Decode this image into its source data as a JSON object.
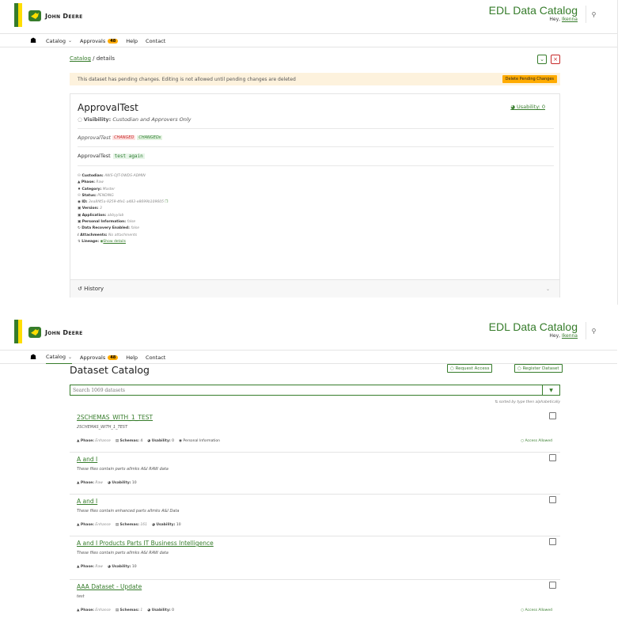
{
  "header": {
    "brand": "John Deere",
    "app_title": "EDL Data Catalog",
    "greeting": "Hey,",
    "user": "Ikenna",
    "search_icon": "magnifier-icon"
  },
  "nav": {
    "catalog": "Catalog",
    "approvals": "Approvals",
    "approvals_count": "48",
    "help": "Help",
    "contact": "Contact"
  },
  "details": {
    "breadcrumb_link": "Catalog",
    "breadcrumb_sep": "/",
    "breadcrumb_current": "details",
    "warning_text": "This dataset has pending changes. Editing is not allowed until pending changes are deleted",
    "delete_pending_label": "Delete Pending Changes",
    "name": "ApprovalTest",
    "visibility_label": "Visibility:",
    "visibility_value": "Custodian and Approvers Only",
    "usability_label": "Usability: 0",
    "desc_old_base": "ApprovalTest",
    "desc_removed": "CHANGED",
    "desc_added": "CHANGEDs",
    "desc_new_base": "ApprovalTest",
    "desc_new_code": "test again",
    "props": [
      {
        "label": "Custodian:",
        "value": "AWS-OJT-OWDS-ADMIN",
        "icon": "people-icon"
      },
      {
        "label": "Phase:",
        "value": "Raw",
        "icon": "phase-icon"
      },
      {
        "label": "Category:",
        "value": "Master",
        "icon": "category-icon"
      },
      {
        "label": "Status:",
        "value": "PENDING",
        "icon": "status-icon"
      },
      {
        "label": "ID:",
        "value": "3ea8f45a-9259-4fe1-a483-e8699b109605",
        "icon": "id-icon"
      },
      {
        "label": "Version:",
        "value": "3",
        "icon": "version-icon"
      },
      {
        "label": "Application:",
        "value": "abbyylab",
        "icon": "application-icon"
      },
      {
        "label": "Personal Information:",
        "value": "false",
        "icon": "personal-info-icon"
      },
      {
        "label": "Data Recovery Enabled:",
        "value": "false",
        "icon": "recovery-icon"
      },
      {
        "label": "Attachments:",
        "value": "No attachments",
        "icon": "attachment-icon"
      },
      {
        "label": "Lineage:",
        "value": "Show details",
        "icon": "lineage-icon"
      }
    ],
    "history_label": "History"
  },
  "catalog": {
    "title": "Dataset Catalog",
    "request_access_label": "Request Access",
    "register_dataset_label": "Register Dataset",
    "search_placeholder": "Search 1069 datasets",
    "sort_note": "sorted by type then alphabetically",
    "entries": [
      {
        "name": "2SCHEMAS_WITH_1_TEST",
        "desc": "2SCHEMAS_WITH_1_TEST",
        "phase": "Enhance",
        "schemas": "4",
        "usability": "0",
        "extra": "Personal Information",
        "access": "Access Allowed"
      },
      {
        "name": "A and I",
        "desc": "These files contain parts allmks A&I RAW data",
        "phase": "Raw",
        "usability": "10"
      },
      {
        "name": "A and I",
        "desc": "These files contain enhanced parts allmks A&I Data",
        "phase": "Enhance",
        "schemas": "161",
        "usability": "10"
      },
      {
        "name": "A and I Products Parts IT Business Intelligence",
        "desc": "These files contain parts allmks A&I RAW data",
        "phase": "Raw",
        "usability": "10"
      },
      {
        "name": "AAA Dataset - Update",
        "desc": "test",
        "phase": "Enhance",
        "schemas": "1",
        "usability": "0",
        "access": "Access Allowed"
      }
    ],
    "labels": {
      "phase": "Phase:",
      "schemas": "Schemas:",
      "usability": "Usability:"
    }
  }
}
